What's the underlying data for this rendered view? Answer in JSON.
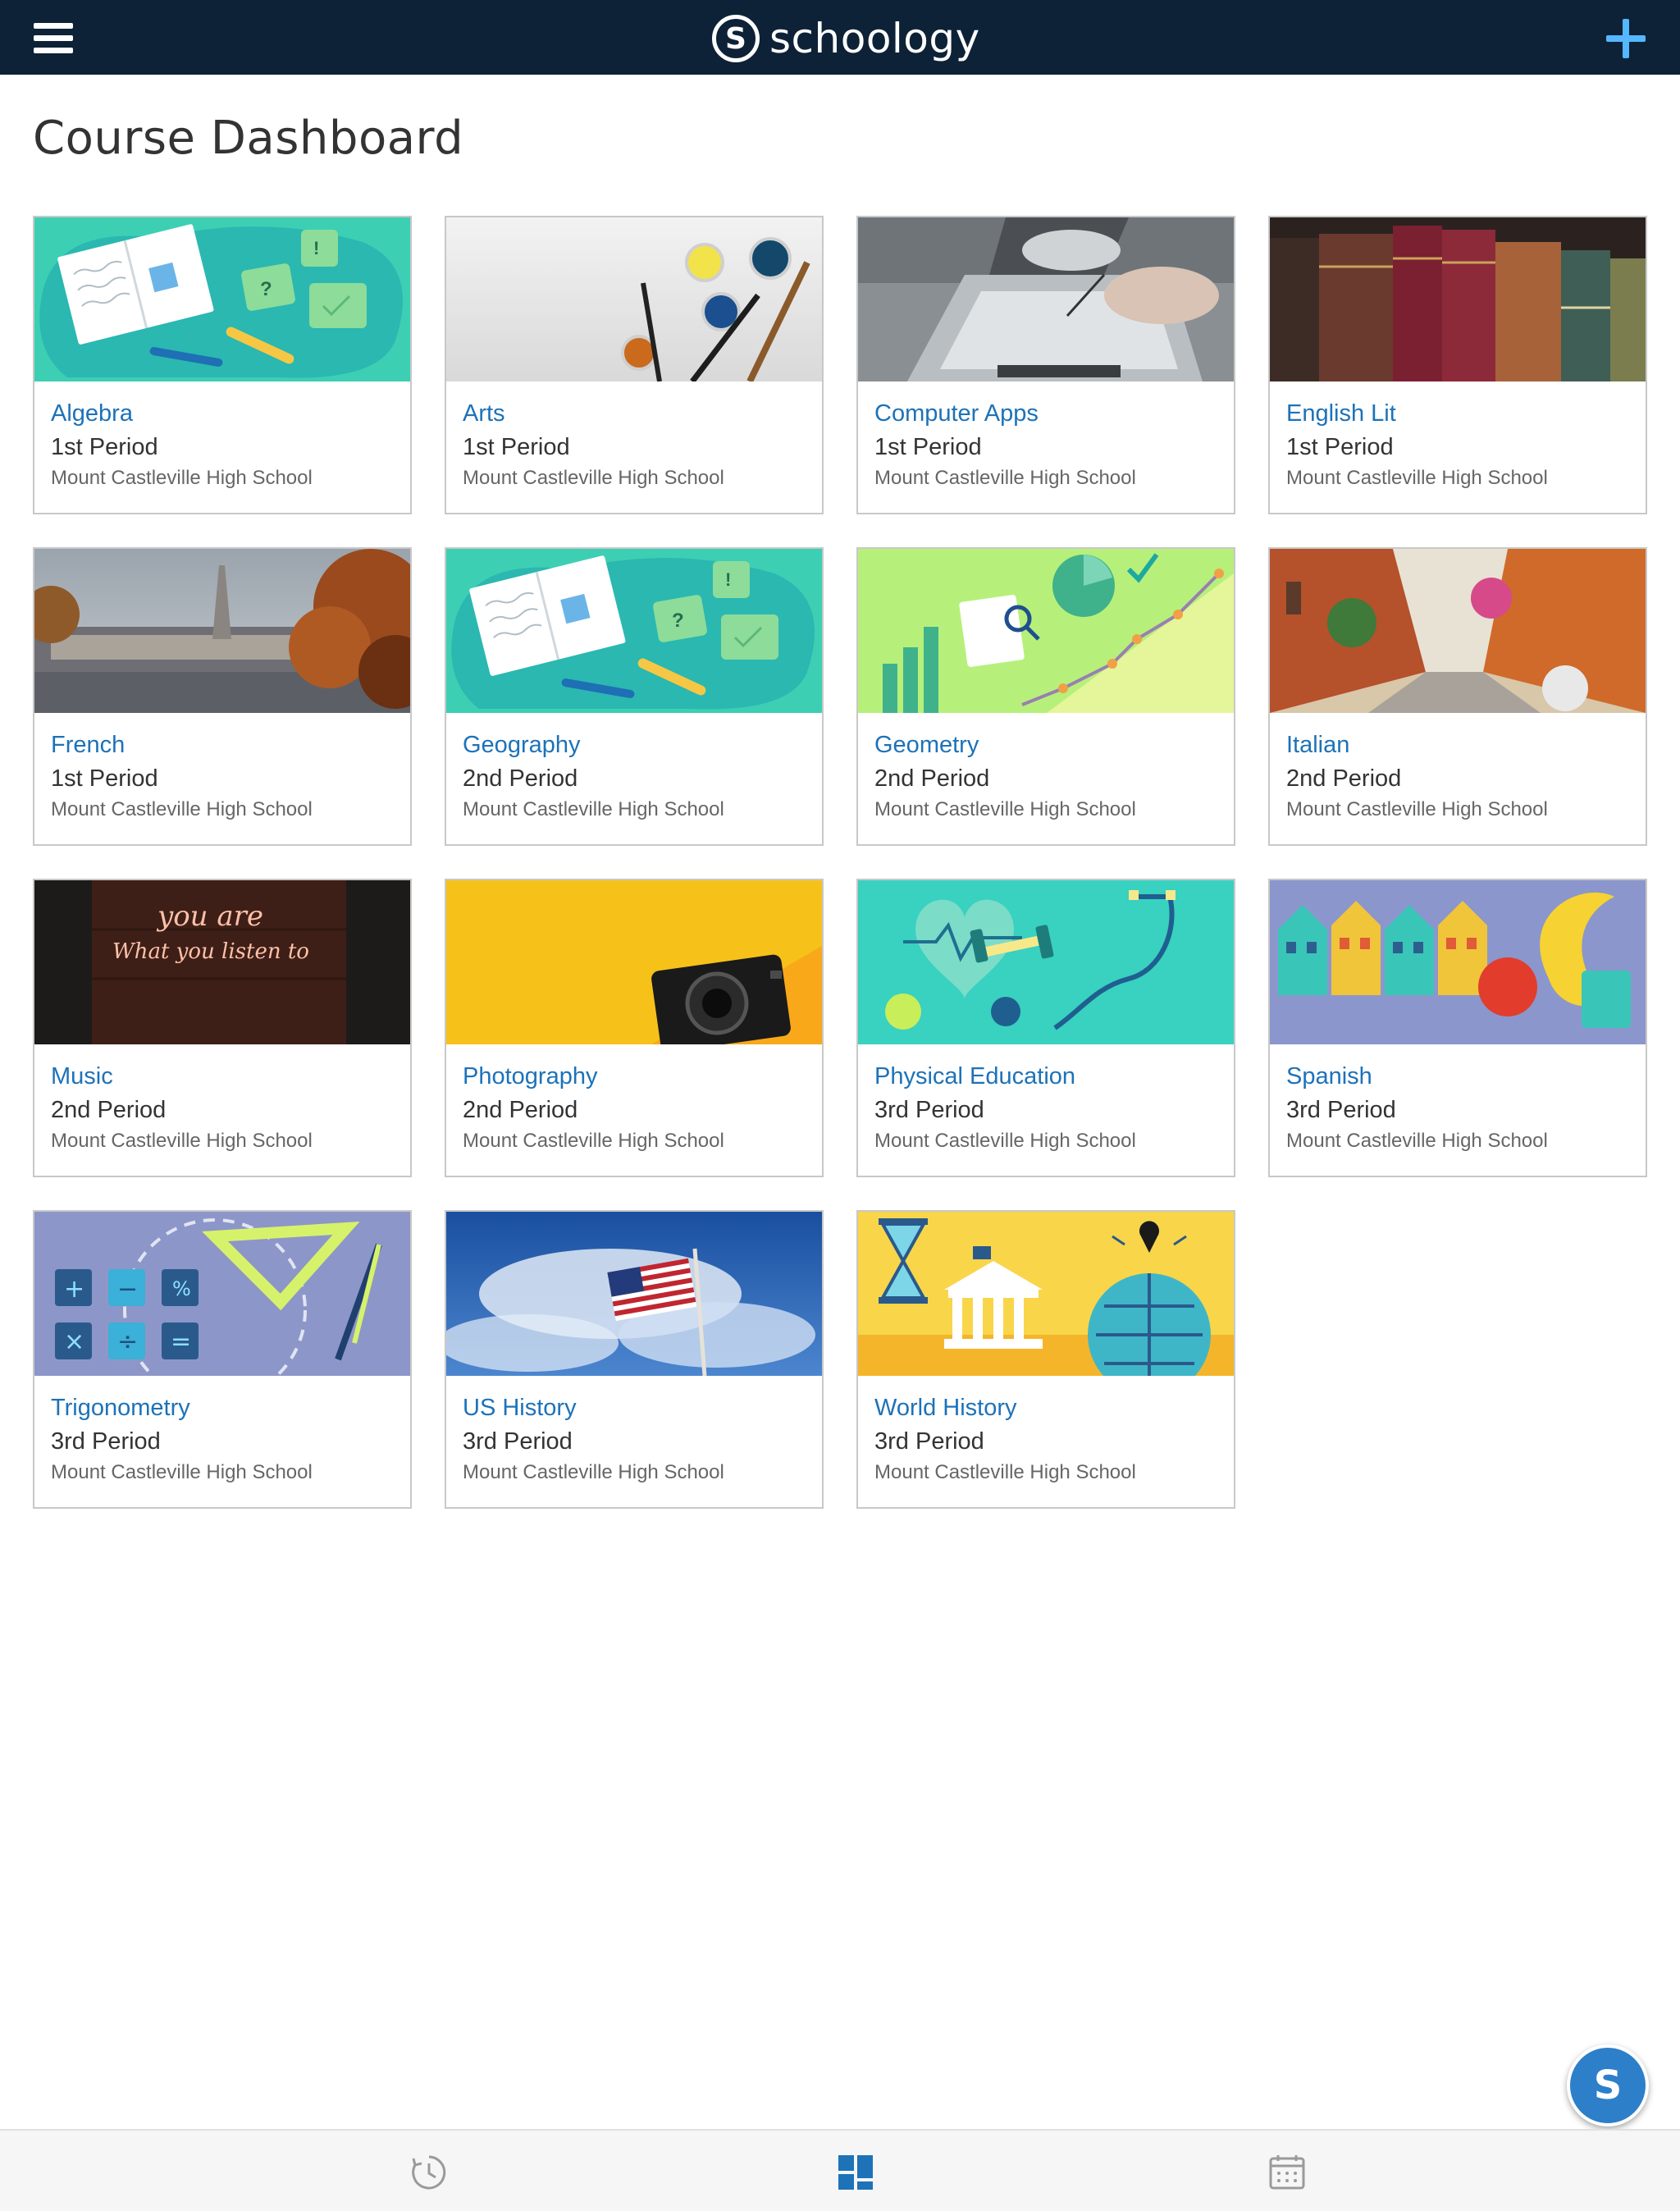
{
  "header": {
    "logo_mark": "S",
    "logo_text": "schoology",
    "menu_icon": "hamburger-menu-icon",
    "add_icon": "plus-icon"
  },
  "page": {
    "title": "Course Dashboard"
  },
  "courses": [
    {
      "name": "Algebra",
      "period": "1st Period",
      "school": "Mount Castleville High School",
      "image": "study-illustration"
    },
    {
      "name": "Arts",
      "period": "1st Period",
      "school": "Mount Castleville High School",
      "image": "paint-brushes-photo"
    },
    {
      "name": "Computer Apps",
      "period": "1st Period",
      "school": "Mount Castleville High School",
      "image": "laptop-desk-photo"
    },
    {
      "name": "English Lit",
      "period": "1st Period",
      "school": "Mount Castleville High School",
      "image": "old-books-photo"
    },
    {
      "name": "French",
      "period": "1st Period",
      "school": "Mount Castleville High School",
      "image": "paris-skyline-photo"
    },
    {
      "name": "Geography",
      "period": "2nd Period",
      "school": "Mount Castleville High School",
      "image": "study-illustration"
    },
    {
      "name": "Geometry",
      "period": "2nd Period",
      "school": "Mount Castleville High School",
      "image": "graph-illustration"
    },
    {
      "name": "Italian",
      "period": "2nd Period",
      "school": "Mount Castleville High School",
      "image": "italian-alley-photo"
    },
    {
      "name": "Music",
      "period": "2nd Period",
      "school": "Mount Castleville High School",
      "image": "neon-sign-photo"
    },
    {
      "name": "Photography",
      "period": "2nd Period",
      "school": "Mount Castleville High School",
      "image": "camera-photo"
    },
    {
      "name": "Physical Education",
      "period": "3rd Period",
      "school": "Mount Castleville High School",
      "image": "fitness-illustration"
    },
    {
      "name": "Spanish",
      "period": "3rd Period",
      "school": "Mount Castleville High School",
      "image": "houses-fruit-illustration"
    },
    {
      "name": "Trigonometry",
      "period": "3rd Period",
      "school": "Mount Castleville High School",
      "image": "math-tools-illustration"
    },
    {
      "name": "US History",
      "period": "3rd Period",
      "school": "Mount Castleville High School",
      "image": "us-flag-photo"
    },
    {
      "name": "World History",
      "period": "3rd Period",
      "school": "Mount Castleville High School",
      "image": "history-illustration"
    }
  ],
  "neon_sign": {
    "line1": "you are",
    "line2": "What you listen to"
  },
  "fab": {
    "label": "S"
  },
  "bottom_nav": [
    {
      "icon": "recent-activity-icon",
      "active": false
    },
    {
      "icon": "courses-grid-icon",
      "active": true
    },
    {
      "icon": "calendar-icon",
      "active": false
    }
  ],
  "colors": {
    "header_bg": "#0d2237",
    "link_blue": "#1d72b8",
    "accent_blue": "#55b7ff",
    "fab_blue": "#2e7fc9"
  }
}
